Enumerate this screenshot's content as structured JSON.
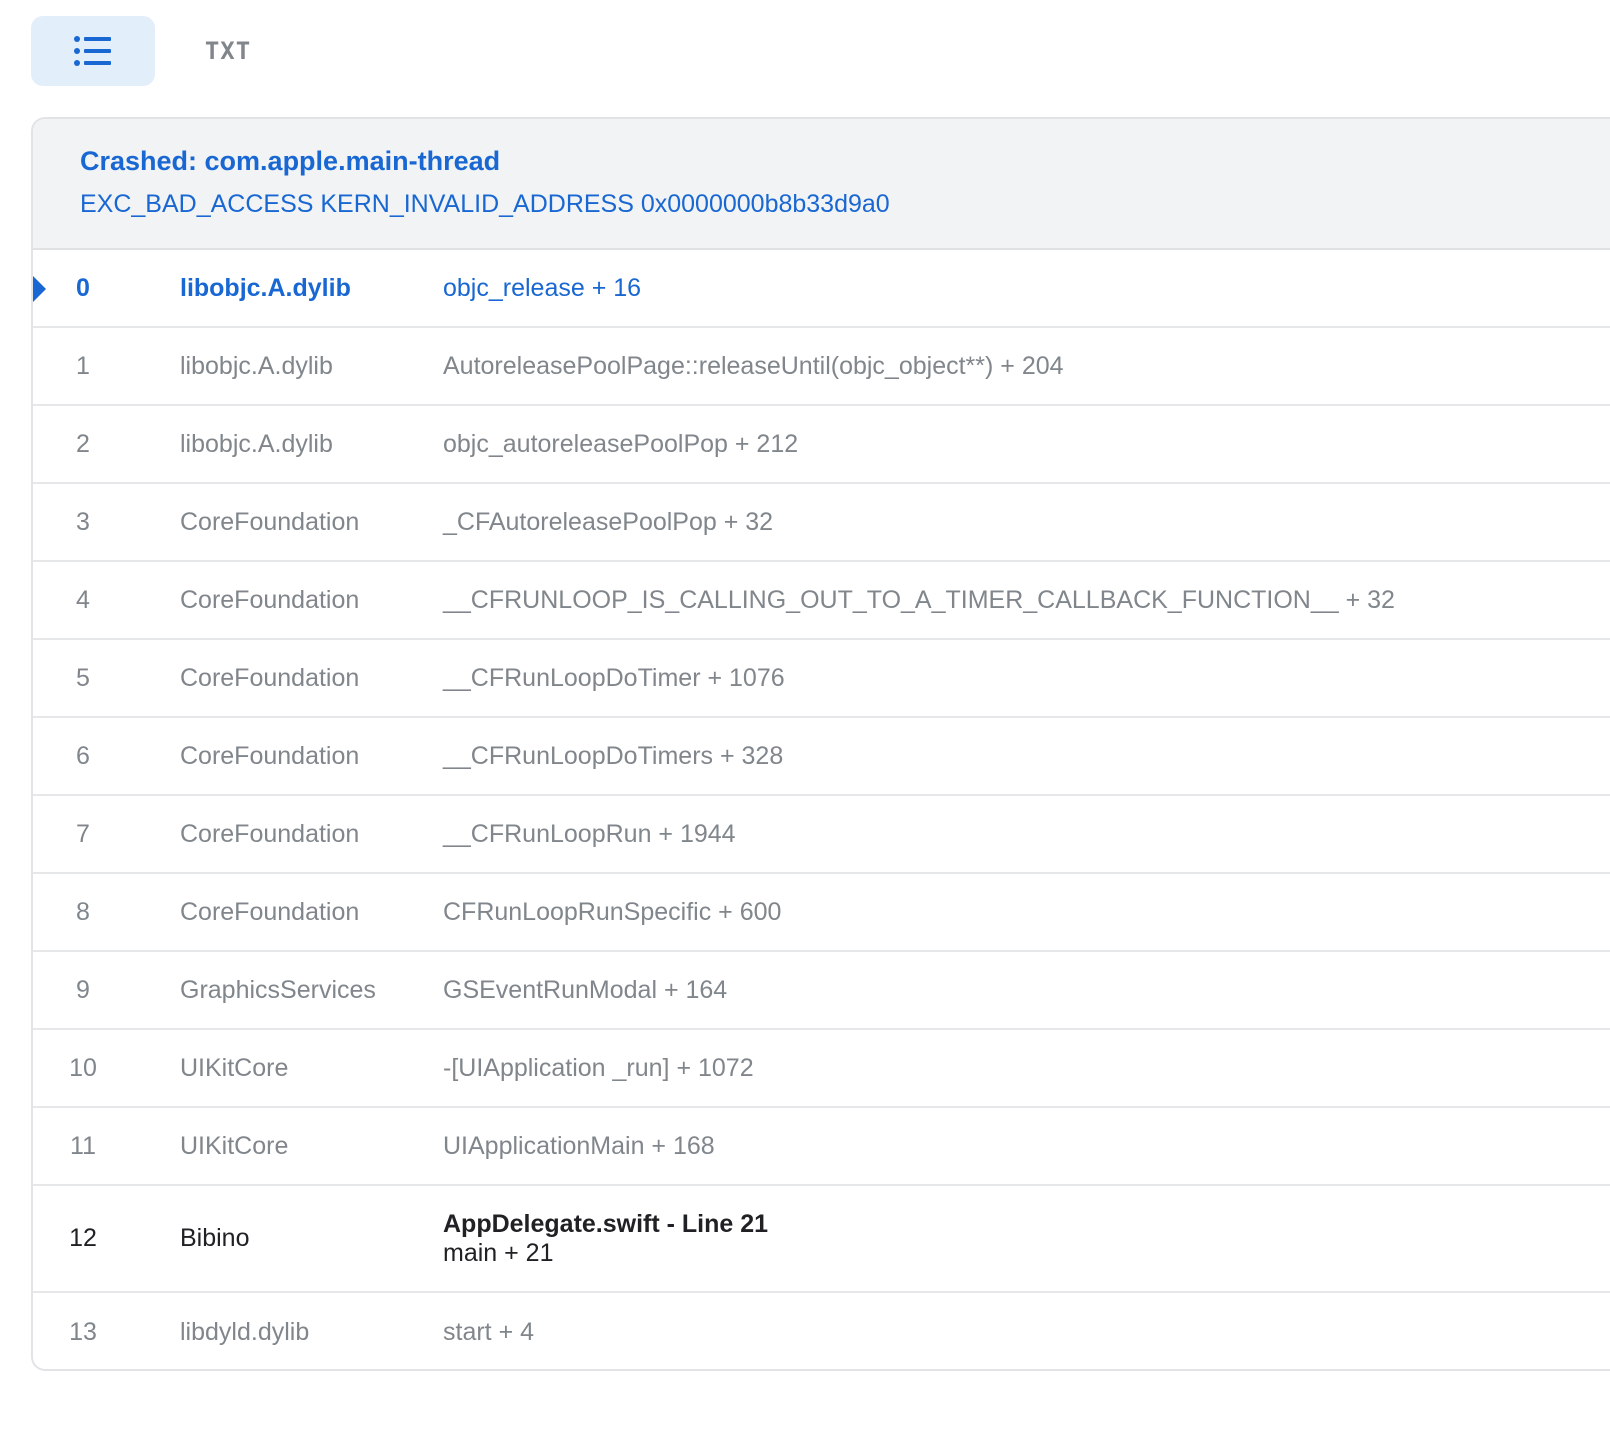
{
  "toolbar": {
    "list_view_icon": "list-icon",
    "txt_label": "TXT"
  },
  "colors": {
    "accent": "#1967d2",
    "header_bg": "#f1f3f4",
    "muted_text": "#80868b",
    "strong_text": "#202124",
    "active_toggle_bg": "#e3eefb"
  },
  "crash": {
    "title": "Crashed: com.apple.main-thread",
    "subtitle": "EXC_BAD_ACCESS KERN_INVALID_ADDRESS 0x0000000b8b33d9a0"
  },
  "frames": [
    {
      "index": "0",
      "library": "libobjc.A.dylib",
      "symbol": "objc_release + 16"
    },
    {
      "index": "1",
      "library": "libobjc.A.dylib",
      "symbol": "AutoreleasePoolPage::releaseUntil(objc_object**) + 204"
    },
    {
      "index": "2",
      "library": "libobjc.A.dylib",
      "symbol": "objc_autoreleasePoolPop + 212"
    },
    {
      "index": "3",
      "library": "CoreFoundation",
      "symbol": "_CFAutoreleasePoolPop + 32"
    },
    {
      "index": "4",
      "library": "CoreFoundation",
      "symbol": "__CFRUNLOOP_IS_CALLING_OUT_TO_A_TIMER_CALLBACK_FUNCTION__ + 32"
    },
    {
      "index": "5",
      "library": "CoreFoundation",
      "symbol": "__CFRunLoopDoTimer + 1076"
    },
    {
      "index": "6",
      "library": "CoreFoundation",
      "symbol": "__CFRunLoopDoTimers + 328"
    },
    {
      "index": "7",
      "library": "CoreFoundation",
      "symbol": "__CFRunLoopRun + 1944"
    },
    {
      "index": "8",
      "library": "CoreFoundation",
      "symbol": "CFRunLoopRunSpecific + 600"
    },
    {
      "index": "9",
      "library": "GraphicsServices",
      "symbol": "GSEventRunModal + 164"
    },
    {
      "index": "10",
      "library": "UIKitCore",
      "symbol": "-[UIApplication _run] + 1072"
    },
    {
      "index": "11",
      "library": "UIKitCore",
      "symbol": "UIApplicationMain + 168"
    },
    {
      "index": "12",
      "library": "Bibino",
      "file": "AppDelegate.swift - Line 21",
      "symbol": "main + 21"
    },
    {
      "index": "13",
      "library": "libdyld.dylib",
      "symbol": "start + 4"
    }
  ]
}
